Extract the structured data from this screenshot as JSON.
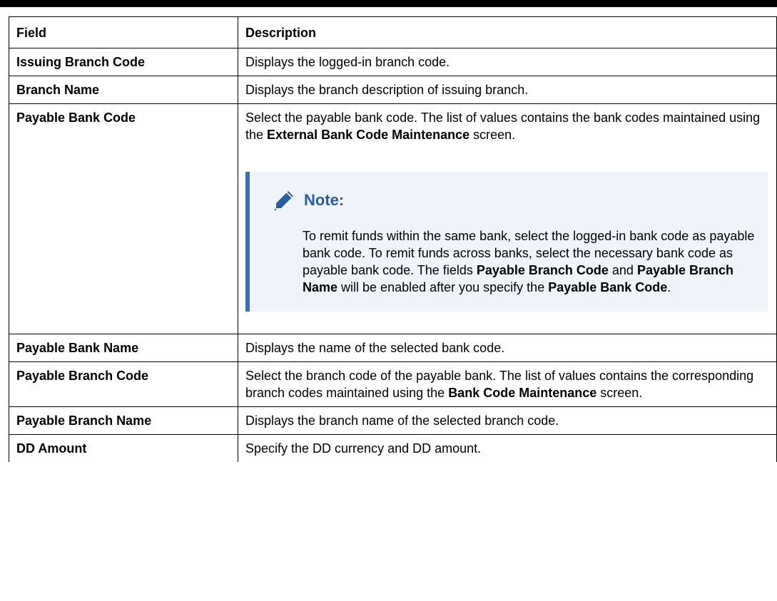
{
  "table": {
    "header": {
      "field": "Field",
      "description": "Description"
    },
    "rows": [
      {
        "field": "Issuing Branch Code",
        "description": "Displays the logged-in branch code."
      },
      {
        "field": "Branch Name",
        "description": "Displays the branch description of issuing branch."
      },
      {
        "field": "Payable Bank Code",
        "desc_pre": "Select the payable bank code. The list of values contains the bank codes maintained using the ",
        "desc_bold": "External Bank Code Maintenance",
        "desc_post": " screen.",
        "note": {
          "title": "Note:",
          "text1": "To remit funds within the same bank, select the logged-in bank code as payable bank code. To remit funds across banks, select the necessary bank code as payable bank code. The fields ",
          "bold1": "Payable Branch Code",
          "text2": " and ",
          "bold2": "Payable Branch Name",
          "text3": " will be enabled after you specify the ",
          "bold3": "Payable Bank Code",
          "text4": "."
        }
      },
      {
        "field": "Payable Bank Name",
        "description": "Displays the name of the selected bank code."
      },
      {
        "field": "Payable Branch Code",
        "desc_pre": "Select the branch code of the payable bank. The list of values contains the corresponding branch codes maintained using the ",
        "desc_bold": "Bank Code Maintenance",
        "desc_post": " screen."
      },
      {
        "field": "Payable Branch Name",
        "description": "Displays the branch name of the selected branch code."
      },
      {
        "field": "DD Amount",
        "description": "Specify the DD currency and DD amount."
      }
    ]
  },
  "colors": {
    "note_bg": "#eef4fa",
    "note_accent": "#3e6fb0",
    "note_title": "#2a5d9c"
  },
  "icons": {
    "note": "pencil-icon"
  }
}
